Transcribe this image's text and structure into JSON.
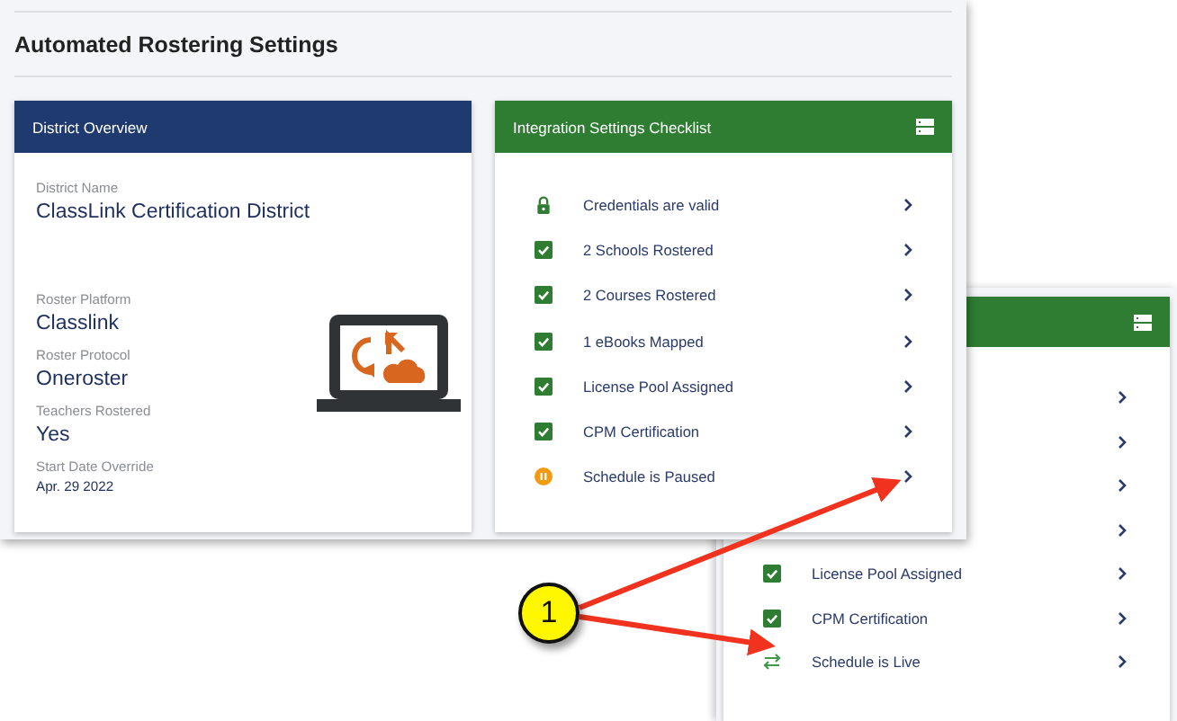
{
  "main_window": {
    "title": "Automated Rostering Settings",
    "district_overview": {
      "title": "District Overview",
      "fields": [
        {
          "label": "District Name",
          "value": "ClassLink Certification District",
          "kind": "large"
        },
        {
          "label": "Roster Platform",
          "value": "Classlink",
          "kind": "large"
        },
        {
          "label": "Roster Protocol",
          "value": "Oneroster",
          "kind": "large"
        },
        {
          "label": "Teachers Rostered",
          "value": "Yes",
          "kind": "large"
        },
        {
          "label": "Start Date Override",
          "value": "Apr. 29 2022",
          "kind": "small"
        }
      ]
    },
    "checklist": {
      "title": "Integration Settings Checklist",
      "items": [
        {
          "label": "Credentials are valid",
          "kind": "lock"
        },
        {
          "label": "2 Schools Rostered",
          "kind": "check"
        },
        {
          "label": "2 Courses Rostered",
          "kind": "check"
        },
        {
          "label": "1 eBooks Mapped",
          "kind": "check"
        },
        {
          "label": "License Pool Assigned",
          "kind": "check"
        },
        {
          "label": "CPM Certification",
          "kind": "check"
        },
        {
          "label": "Schedule is Paused",
          "kind": "paused"
        }
      ]
    }
  },
  "back_window": {
    "items": [
      {
        "kind": "covered"
      },
      {
        "kind": "covered"
      },
      {
        "kind": "covered"
      },
      {
        "kind": "covered"
      },
      {
        "label": "License Pool Assigned",
        "kind": "check"
      },
      {
        "label": "CPM Certification",
        "kind": "check"
      },
      {
        "label": "Schedule is Live",
        "kind": "live"
      }
    ]
  },
  "callout": {
    "number": "1"
  }
}
